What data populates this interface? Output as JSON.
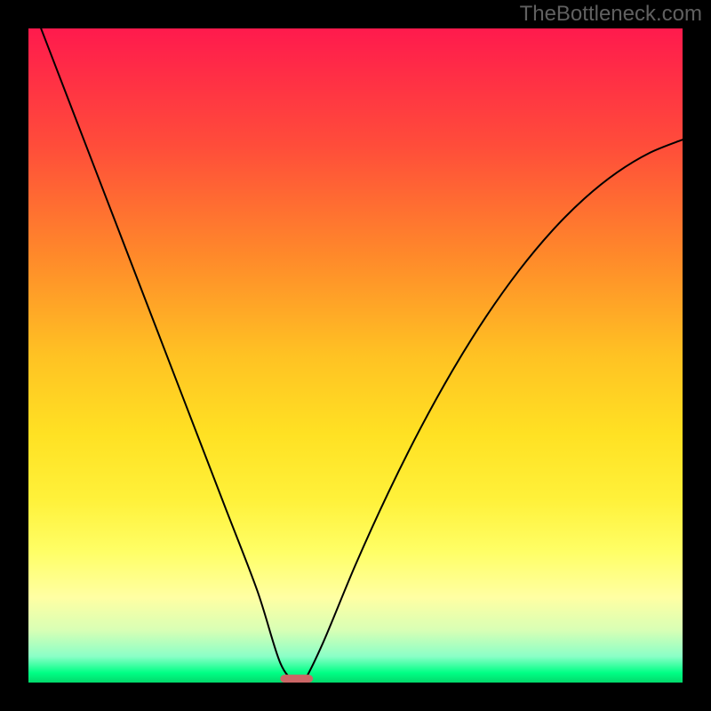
{
  "watermark": "TheBottleneck.com",
  "chart_data": {
    "type": "line",
    "title": "",
    "xlabel": "",
    "ylabel": "",
    "xlim": [
      0,
      100
    ],
    "ylim": [
      0,
      100
    ],
    "grid": false,
    "legend": false,
    "background": "red-yellow-green vertical gradient (bottleneck heatmap)",
    "series": [
      {
        "name": "bottleneck-curve",
        "x": [
          0,
          5,
          10,
          15,
          20,
          25,
          30,
          35,
          38.5,
          41,
          42,
          45,
          50,
          55,
          60,
          65,
          70,
          75,
          80,
          85,
          90,
          95,
          100
        ],
        "values": [
          105,
          92,
          79,
          66,
          53,
          40,
          27,
          14,
          3,
          0,
          0,
          6,
          18,
          29,
          39,
          48,
          56,
          63,
          69,
          74,
          78,
          81,
          83
        ]
      }
    ],
    "marker": {
      "name": "optimal-point-marker",
      "x": 41,
      "y": 0,
      "color": "#cc6666",
      "width_pct": 5,
      "height_pct": 1.2
    }
  }
}
